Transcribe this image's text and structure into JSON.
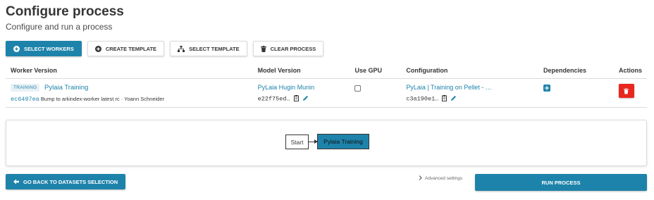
{
  "header": {
    "title": "Configure process",
    "subtitle": "Configure and run a process"
  },
  "toolbar": {
    "select_workers": "Select workers",
    "create_template": "Create template",
    "select_template": "Select template",
    "clear_process": "Clear process"
  },
  "table": {
    "columns": {
      "worker_version": "Worker Version",
      "model_version": "Model Version",
      "use_gpu": "Use GPU",
      "configuration": "Configuration",
      "dependencies": "Dependencies",
      "actions": "Actions"
    },
    "rows": [
      {
        "type_tag": "TRAINING",
        "worker_name": "Pylaia Training",
        "revision_hash": "ec6497ea",
        "revision_message": "Bump to arkindex-worker latest rc · Yoann Schneider",
        "model_name": "PyLaia Hugin Munin",
        "model_hash": "e22f75ed…",
        "use_gpu": false,
        "config_name": "PyLaia | Training on Pellet - …",
        "config_hash": "c3a190e1…"
      }
    ]
  },
  "graph": {
    "start_label": "Start",
    "worker_label": "Pylaia Training"
  },
  "footer": {
    "back_label": "Go back to datasets selection",
    "advanced_label": "Advanced settings",
    "run_label": "Run process"
  },
  "colors": {
    "primary": "#1e83aa",
    "danger": "#e8281e"
  }
}
